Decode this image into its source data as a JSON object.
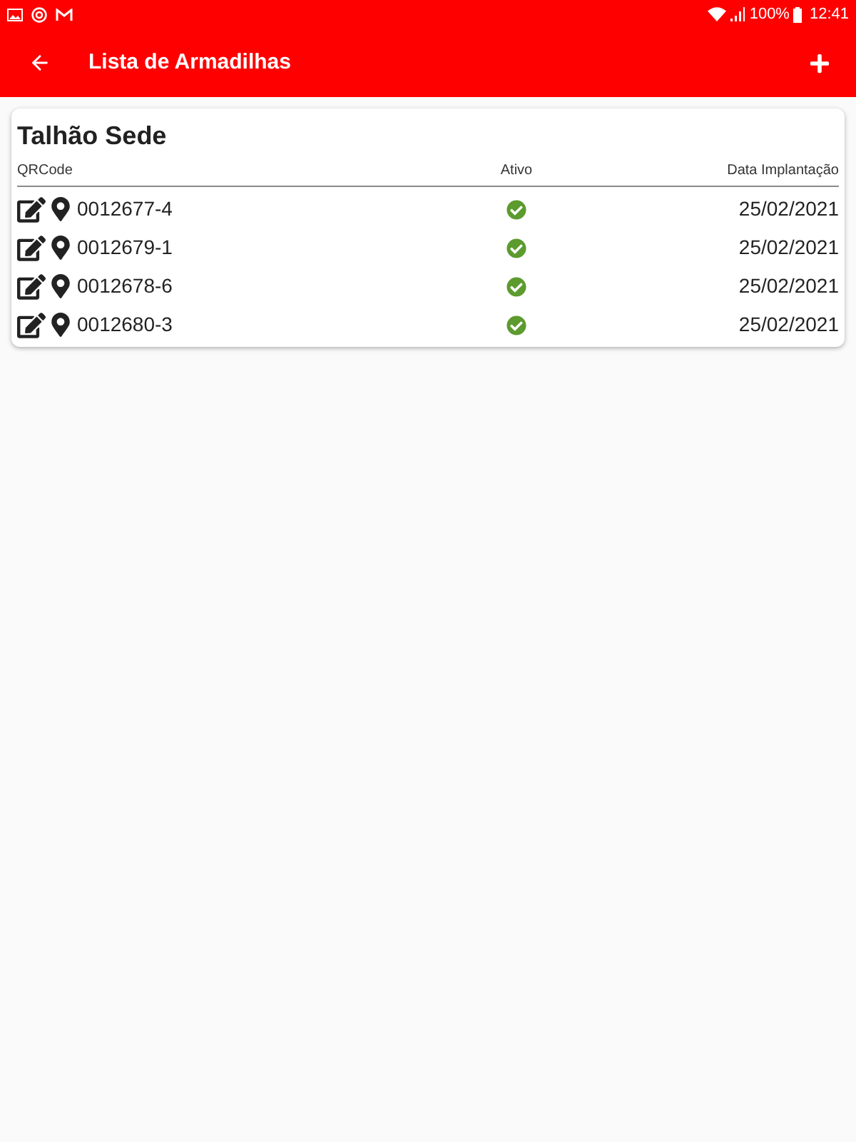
{
  "status_bar": {
    "battery": "100%",
    "time": "12:41"
  },
  "app_bar": {
    "title": "Lista de Armadilhas"
  },
  "card": {
    "title": "Talhão Sede",
    "columns": [
      "QRCode",
      "Ativo",
      "Data Implantação"
    ],
    "rows": [
      {
        "qrcode": "0012677-4",
        "active": true,
        "date": "25/02/2021"
      },
      {
        "qrcode": "0012679-1",
        "active": true,
        "date": "25/02/2021"
      },
      {
        "qrcode": "0012678-6",
        "active": true,
        "date": "25/02/2021"
      },
      {
        "qrcode": "0012680-3",
        "active": true,
        "date": "25/02/2021"
      }
    ]
  }
}
